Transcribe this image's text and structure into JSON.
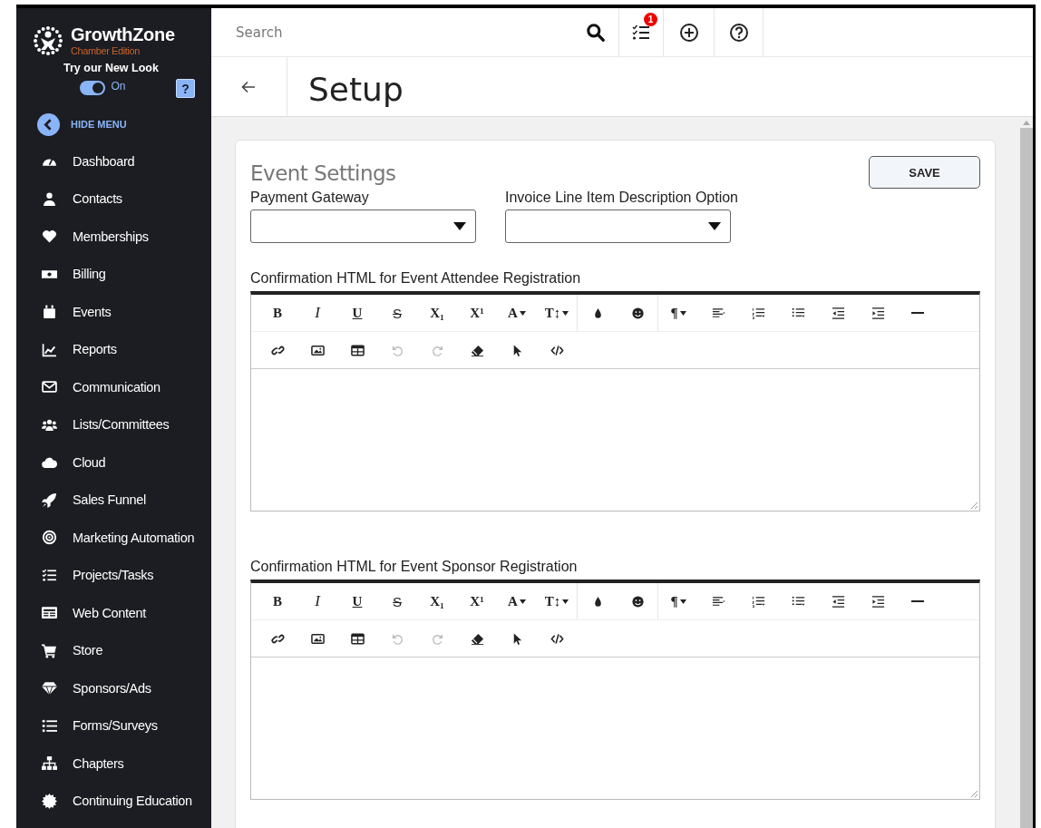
{
  "sidebar": {
    "brand": {
      "name": "GrowthZone",
      "edition": "Chamber Edition"
    },
    "new_look": {
      "label": "Try our New Look",
      "on": true,
      "state_label": "On",
      "help": "?"
    },
    "hide_menu": "HIDE MENU",
    "items": [
      {
        "label": "Dashboard",
        "kind": "gauge"
      },
      {
        "label": "Contacts",
        "kind": "person"
      },
      {
        "label": "Memberships",
        "kind": "heart"
      },
      {
        "label": "Billing",
        "kind": "banknote"
      },
      {
        "label": "Events",
        "kind": "calendar"
      },
      {
        "label": "Reports",
        "kind": "chart"
      },
      {
        "label": "Communication",
        "kind": "envelope"
      },
      {
        "label": "Lists/Committees",
        "kind": "people"
      },
      {
        "label": "Cloud",
        "kind": "cloud"
      },
      {
        "label": "Sales Funnel",
        "kind": "rocket"
      },
      {
        "label": "Marketing Automation",
        "kind": "target"
      },
      {
        "label": "Projects/Tasks",
        "kind": "checklist"
      },
      {
        "label": "Web Content",
        "kind": "newspaper"
      },
      {
        "label": "Store",
        "kind": "cart"
      },
      {
        "label": "Sponsors/Ads",
        "kind": "diamond"
      },
      {
        "label": "Forms/Surveys",
        "kind": "list"
      },
      {
        "label": "Chapters",
        "kind": "sitemap"
      },
      {
        "label": "Continuing Education",
        "kind": "seal"
      }
    ]
  },
  "topbar": {
    "search": {
      "placeholder": "Search"
    },
    "tasks_badge": "1"
  },
  "header": {
    "title": "Setup"
  },
  "card": {
    "title": "Event Settings",
    "save": "SAVE",
    "fields": [
      {
        "label": "Payment Gateway"
      },
      {
        "label": "Invoice Line Item Description Option"
      }
    ],
    "editors": [
      {
        "label": "Confirmation HTML for Event Attendee Registration",
        "toolbar": [
          [
            [
              {
                "kind": "text",
                "label": "B",
                "disabled": false
              },
              {
                "kind": "italic",
                "label": "I",
                "disabled": false
              },
              {
                "kind": "underline",
                "label": "U",
                "disabled": false
              },
              {
                "kind": "strike",
                "label": "S",
                "disabled": false
              },
              {
                "kind": "text",
                "label": "X₁",
                "disabled": false
              },
              {
                "kind": "text",
                "label": "X¹",
                "disabled": false
              },
              {
                "kind": "caret",
                "label": "A",
                "disabled": false
              },
              {
                "kind": "caret",
                "label": "T↕",
                "disabled": false
              }
            ],
            [
              {
                "kind": "droplet",
                "disabled": false
              },
              {
                "kind": "smiley",
                "disabled": false
              }
            ],
            [
              {
                "kind": "caret",
                "label": "¶",
                "disabled": false
              },
              {
                "kind": "align",
                "disabled": false
              },
              {
                "kind": "ordered",
                "disabled": false
              },
              {
                "kind": "unordered",
                "disabled": false
              },
              {
                "kind": "outdent",
                "disabled": false
              },
              {
                "kind": "indent",
                "disabled": false
              },
              {
                "kind": "rule",
                "disabled": false
              }
            ]
          ],
          [
            [
              {
                "kind": "link",
                "disabled": false
              },
              {
                "kind": "image",
                "disabled": false
              },
              {
                "kind": "table",
                "disabled": false
              },
              {
                "kind": "undo",
                "disabled": true
              },
              {
                "kind": "redo",
                "disabled": true
              },
              {
                "kind": "eraser",
                "disabled": false
              },
              {
                "kind": "pointer",
                "disabled": false
              },
              {
                "kind": "code",
                "disabled": false
              }
            ]
          ]
        ]
      },
      {
        "label": "Confirmation HTML for Event Sponsor Registration",
        "toolbar": [
          [
            [
              {
                "kind": "text",
                "label": "B",
                "disabled": false
              },
              {
                "kind": "italic",
                "label": "I",
                "disabled": false
              },
              {
                "kind": "underline",
                "label": "U",
                "disabled": false
              },
              {
                "kind": "strike",
                "label": "S",
                "disabled": false
              },
              {
                "kind": "text",
                "label": "X₁",
                "disabled": false
              },
              {
                "kind": "text",
                "label": "X¹",
                "disabled": false
              },
              {
                "kind": "caret",
                "label": "A",
                "disabled": false
              },
              {
                "kind": "caret",
                "label": "T↕",
                "disabled": false
              }
            ],
            [
              {
                "kind": "droplet",
                "disabled": false
              },
              {
                "kind": "smiley",
                "disabled": false
              }
            ],
            [
              {
                "kind": "caret",
                "label": "¶",
                "disabled": false
              },
              {
                "kind": "align",
                "disabled": false
              },
              {
                "kind": "ordered",
                "disabled": false
              },
              {
                "kind": "unordered",
                "disabled": false
              },
              {
                "kind": "outdent",
                "disabled": false
              },
              {
                "kind": "indent",
                "disabled": false
              },
              {
                "kind": "rule",
                "disabled": false
              }
            ]
          ],
          [
            [
              {
                "kind": "link",
                "disabled": false
              },
              {
                "kind": "image",
                "disabled": false
              },
              {
                "kind": "table",
                "disabled": false
              },
              {
                "kind": "undo",
                "disabled": true
              },
              {
                "kind": "redo",
                "disabled": true
              },
              {
                "kind": "eraser",
                "disabled": false
              },
              {
                "kind": "pointer",
                "disabled": false
              },
              {
                "kind": "code",
                "disabled": false
              }
            ]
          ]
        ]
      }
    ]
  }
}
